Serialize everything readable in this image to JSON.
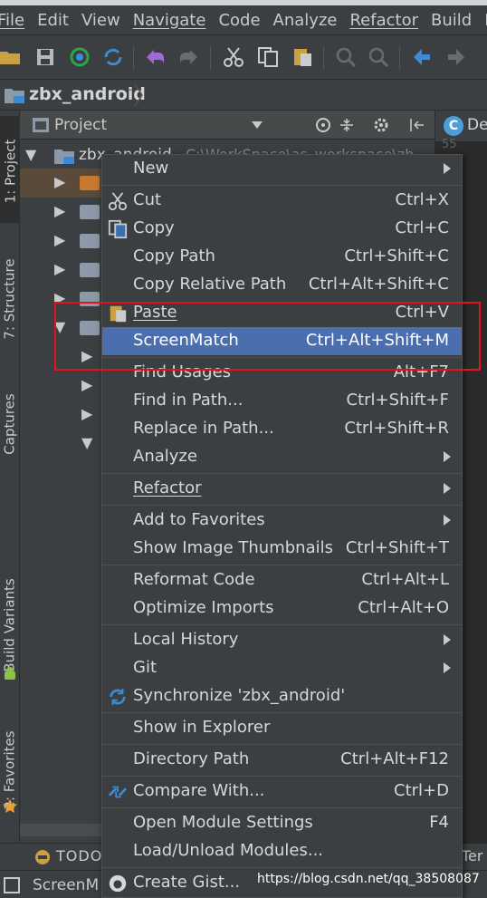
{
  "menubar": [
    "File",
    "Edit",
    "View",
    "Navigate",
    "Code",
    "Analyze",
    "Refactor",
    "Build",
    "R"
  ],
  "breadcrumb": "zbx_android",
  "left_tabs": [
    "1: Project",
    "7: Structure",
    "Captures",
    "Build Variants",
    "2: Favorites"
  ],
  "panel": {
    "title": "Project"
  },
  "tree": {
    "root_name": "zbx_android",
    "root_path": "C:\\WorkSpace\\as_workspace\\zb"
  },
  "editor_tab": {
    "label": "De",
    "line_number": "55"
  },
  "bottom": {
    "todo": "TODO",
    "terminal": "Ter",
    "status": "ScreenM"
  },
  "watermark": "https://blog.csdn.net/qq_38508087",
  "context_menu": {
    "new": "New",
    "cut": "Cut",
    "cut_sc": "Ctrl+X",
    "copy": "Copy",
    "copy_sc": "Ctrl+C",
    "copy_path": "Copy Path",
    "copy_path_sc": "Ctrl+Shift+C",
    "copy_rel": "Copy Relative Path",
    "copy_rel_sc": "Ctrl+Alt+Shift+C",
    "paste": "Paste",
    "paste_sc": "Ctrl+V",
    "screenmatch": "ScreenMatch",
    "screenmatch_sc": "Ctrl+Alt+Shift+M",
    "find_usages": "Find Usages",
    "find_usages_sc": "Alt+F7",
    "find_in_path": "Find in Path...",
    "find_in_path_sc": "Ctrl+Shift+F",
    "replace_in_path": "Replace in Path...",
    "replace_in_path_sc": "Ctrl+Shift+R",
    "analyze": "Analyze",
    "refactor": "Refactor",
    "add_fav": "Add to Favorites",
    "thumbnails": "Show Image Thumbnails",
    "thumbnails_sc": "Ctrl+Shift+T",
    "reformat": "Reformat Code",
    "reformat_sc": "Ctrl+Alt+L",
    "optimize": "Optimize Imports",
    "optimize_sc": "Ctrl+Alt+O",
    "local_history": "Local History",
    "git": "Git",
    "sync": "Synchronize 'zbx_android'",
    "explorer": "Show in Explorer",
    "dir_path": "Directory Path",
    "dir_path_sc": "Ctrl+Alt+F12",
    "compare": "Compare With...",
    "compare_sc": "Ctrl+D",
    "module_settings": "Open Module Settings",
    "module_settings_sc": "F4",
    "load_unload": "Load/Unload Modules...",
    "gist": "Create Gist..."
  },
  "colors": {
    "selection": "#4b6eaf",
    "highlight_box": "#e0141e",
    "background": "#3c3f41"
  }
}
